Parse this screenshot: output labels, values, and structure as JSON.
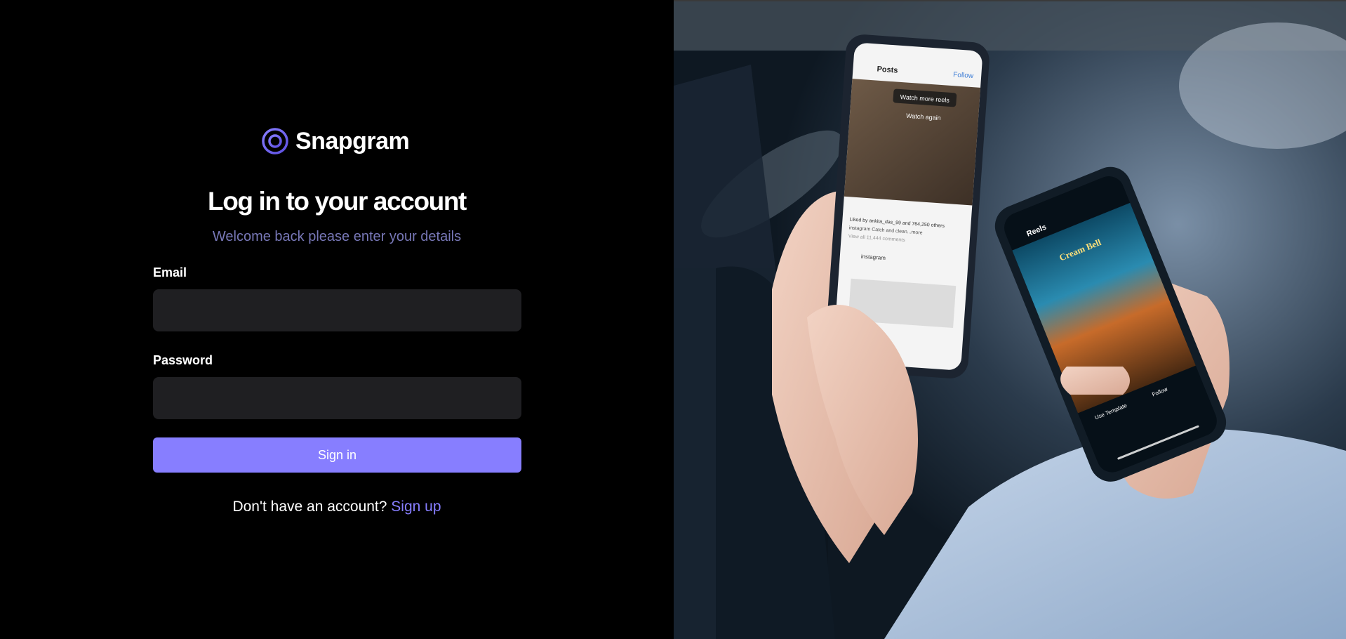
{
  "brand": {
    "name": "Snapgram",
    "accent_color": "#877eff",
    "logo_icon": "snapgram-logo-icon"
  },
  "auth": {
    "title": "Log in to your account",
    "subtitle": "Welcome back please enter your details",
    "email_label": "Email",
    "email_value": "",
    "password_label": "Password",
    "password_value": "",
    "signin_label": "Sign in",
    "no_account_text": "Don't have an account?",
    "signup_link": "Sign up"
  },
  "hero_image": {
    "left_phone": {
      "header_title": "Posts",
      "follow_label": "Follow",
      "overlay_1": "Watch more reels",
      "overlay_2": "Watch again",
      "liked_by": "Liked by ankita_das_99 and 764,250 others",
      "caption": "instagram Catch and clean...more",
      "comments": "View all 11,444 comments",
      "post_account": "instagram"
    },
    "right_phone": {
      "header_title": "Reels",
      "sign_text": "Cream Bell",
      "template_label": "Use Template",
      "follow_label": "Follow"
    }
  }
}
